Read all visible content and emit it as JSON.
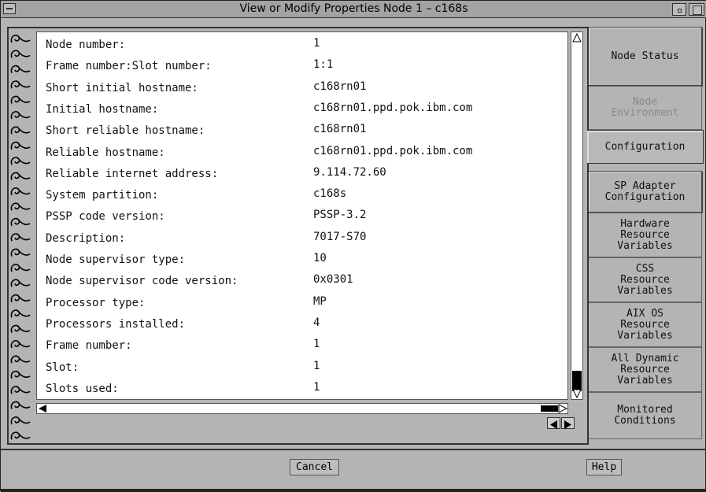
{
  "window": {
    "title": "View or Modify Properties Node 1 – c168s"
  },
  "properties": [
    {
      "label": "Node number:",
      "value": "1"
    },
    {
      "label": "Frame number:Slot number:",
      "value": "1:1"
    },
    {
      "label": "Short initial hostname:",
      "value": "c168rn01"
    },
    {
      "label": "Initial hostname:",
      "value": "c168rn01.ppd.pok.ibm.com"
    },
    {
      "label": "Short reliable hostname:",
      "value": "c168rn01"
    },
    {
      "label": "Reliable hostname:",
      "value": "c168rn01.ppd.pok.ibm.com"
    },
    {
      "label": "Reliable internet address:",
      "value": "9.114.72.60"
    },
    {
      "label": "System partition:",
      "value": "c168s"
    },
    {
      "label": "PSSP code version:",
      "value": "PSSP-3.2"
    },
    {
      "label": "Description:",
      "value": "7017-S70"
    },
    {
      "label": "Node supervisor type:",
      "value": "10"
    },
    {
      "label": "Node supervisor code version:",
      "value": "0x0301"
    },
    {
      "label": "Processor type:",
      "value": "MP"
    },
    {
      "label": "Processors installed:",
      "value": "4"
    },
    {
      "label": "Frame number:",
      "value": "1"
    },
    {
      "label": "Slot:",
      "value": "1"
    },
    {
      "label": "Slots used:",
      "value": "1"
    }
  ],
  "tabs": [
    {
      "label": "Node Status",
      "state": "normal"
    },
    {
      "label": "Node Environment",
      "state": "disabled"
    },
    {
      "label": "Configuration",
      "state": "active"
    },
    {
      "label": "SP Adapter Configuration",
      "state": "normal"
    },
    {
      "label": "Hardware Resource Variables",
      "state": "normal"
    },
    {
      "label": "CSS Resource Variables",
      "state": "normal"
    },
    {
      "label": "AIX OS Resource Variables",
      "state": "normal"
    },
    {
      "label": "All Dynamic Resource Variables",
      "state": "normal"
    },
    {
      "label": "Monitored Conditions",
      "state": "normal"
    }
  ],
  "tab_lines": [
    [
      "Node Status"
    ],
    [
      "Node",
      "Environment"
    ],
    [
      "Configuration"
    ],
    [
      "SP Adapter",
      "Configuration"
    ],
    [
      "Hardware",
      "Resource",
      "Variables"
    ],
    [
      "CSS",
      "Resource",
      "Variables"
    ],
    [
      "AIX OS",
      "Resource",
      "Variables"
    ],
    [
      "All Dynamic",
      "Resource",
      "Variables"
    ],
    [
      "Monitored",
      "Conditions"
    ]
  ],
  "buttons": {
    "cancel": "Cancel",
    "help": "Help"
  },
  "icons": {
    "window_menu": "window-menu-icon",
    "minimize": "minimize-icon",
    "maximize": "maximize-icon",
    "scroll_up": "arrow-up-icon",
    "scroll_down": "arrow-down-icon",
    "scroll_left": "arrow-left-icon",
    "scroll_right": "arrow-right-icon",
    "page_prev": "page-prev-icon",
    "page_next": "page-next-icon"
  }
}
